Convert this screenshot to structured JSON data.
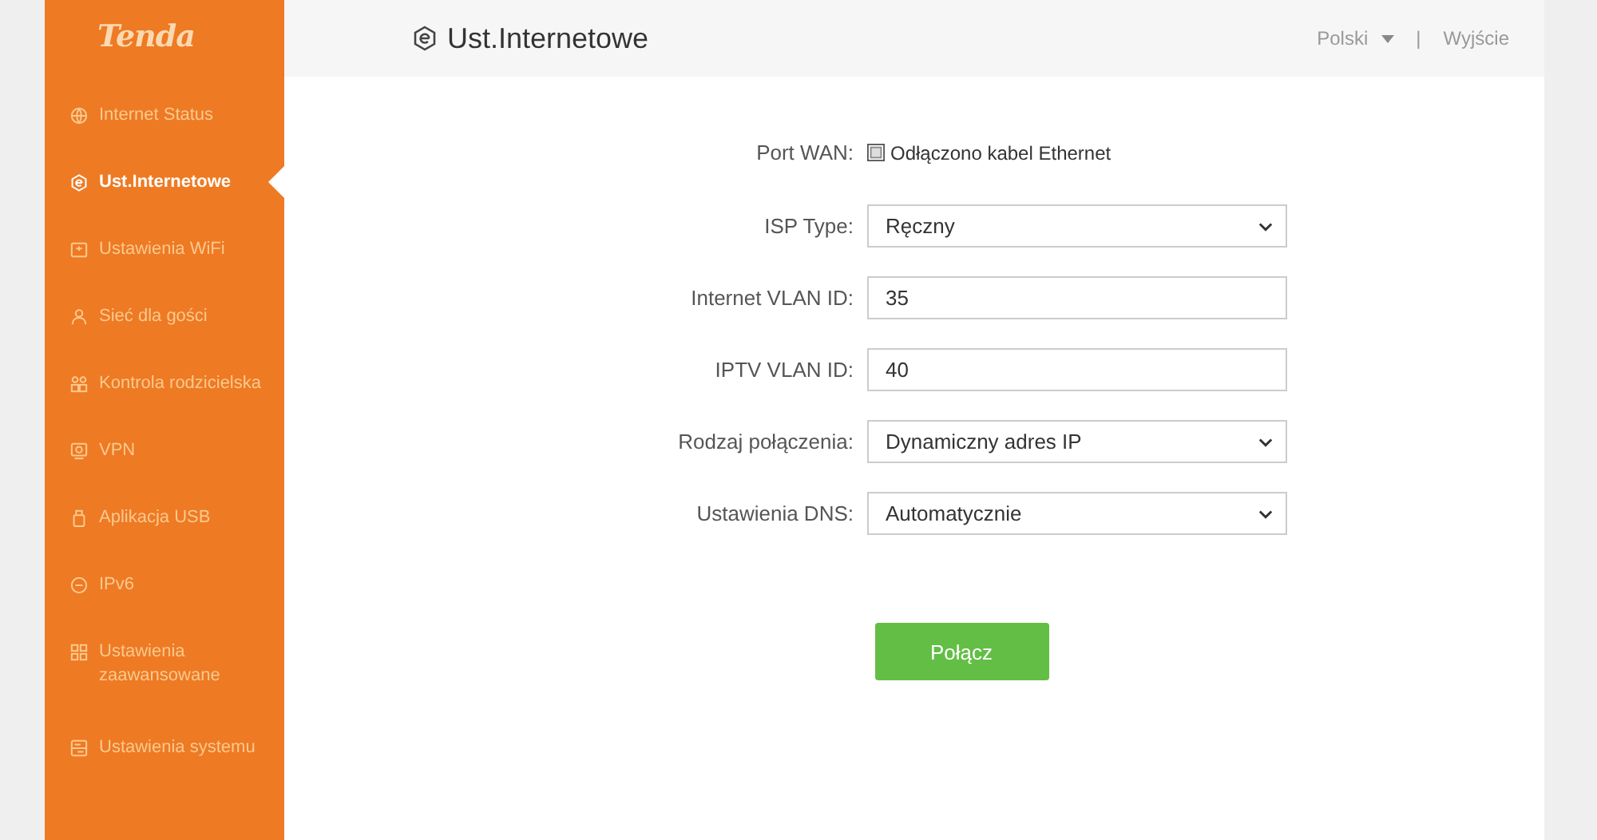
{
  "sidebar": {
    "logo": "Tenda",
    "items": [
      {
        "label": "Internet Status",
        "selected": false
      },
      {
        "label": "Ust.Internetowe",
        "selected": true
      },
      {
        "label": "Ustawienia WiFi",
        "selected": false
      },
      {
        "label": "Sieć dla gości",
        "selected": false
      },
      {
        "label": "Kontrola rodzicielska",
        "selected": false
      },
      {
        "label": "VPN",
        "selected": false
      },
      {
        "label": "Aplikacja USB",
        "selected": false
      },
      {
        "label": "IPv6",
        "selected": false
      },
      {
        "label": "Ustawienia zaawansowane",
        "selected": false
      },
      {
        "label": "Ustawienia systemu",
        "selected": false
      }
    ]
  },
  "header": {
    "title": "Ust.Internetowe",
    "language": "Polski",
    "separator": "|",
    "logout": "Wyjście"
  },
  "form": {
    "rows": [
      {
        "kind": "status",
        "label": "Port WAN:",
        "value": "Odłączono kabel Ethernet"
      },
      {
        "kind": "select",
        "label": "ISP Type:",
        "value": "Ręczny"
      },
      {
        "kind": "text",
        "label": "Internet VLAN ID:",
        "value": "35"
      },
      {
        "kind": "text",
        "label": "IPTV VLAN ID:",
        "value": "40"
      },
      {
        "kind": "select",
        "label": "Rodzaj połączenia:",
        "value": "Dynamiczny adres IP"
      },
      {
        "kind": "select",
        "label": "Ustawienia DNS:",
        "value": "Automatycznie"
      }
    ],
    "button": "Połącz"
  }
}
